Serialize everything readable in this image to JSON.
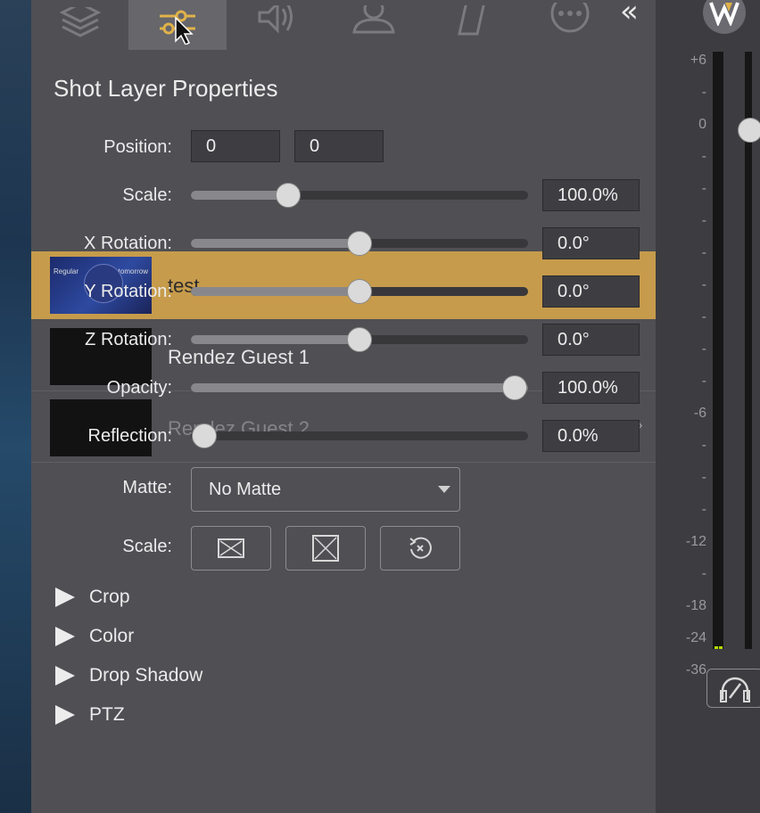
{
  "toolbar": {
    "icons": [
      "layers-icon",
      "adjustments-icon",
      "speaker-icon",
      "person-icon",
      "slash-shape-icon",
      "more-icon"
    ],
    "active_index": 1,
    "collapse_label": "«"
  },
  "panel": {
    "title": "Shot Layer Properties",
    "position": {
      "label": "Position:",
      "x": "0",
      "y": "0"
    },
    "scale": {
      "label": "Scale:",
      "value": "100.0%",
      "fraction": 0.27
    },
    "x_rotation": {
      "label": "X Rotation:",
      "value": "0.0°",
      "fraction": 0.5
    },
    "y_rotation": {
      "label": "Y Rotation:",
      "value": "0.0°",
      "fraction": 0.5
    },
    "z_rotation": {
      "label": "Z Rotation:",
      "value": "0.0°",
      "fraction": 0.5
    },
    "opacity": {
      "label": "Opacity:",
      "value": "100.0%",
      "fraction": 1.0
    },
    "reflection": {
      "label": "Reflection:",
      "value": "0.0%",
      "fraction": 0.0
    },
    "matte": {
      "label": "Matte:",
      "value": "No Matte"
    },
    "scale_buttons": {
      "label": "Scale:",
      "icons": [
        "fit-icon",
        "fill-icon",
        "reset-icon"
      ]
    },
    "sections": [
      "Crop",
      "Color",
      "Drop Shadow",
      "PTZ"
    ]
  },
  "layers_list": {
    "rows": [
      {
        "name": "test",
        "selected": true
      },
      {
        "name": "Rendez Guest 1",
        "selected": false
      },
      {
        "name": "Rendez Guest 2",
        "selected": false
      }
    ],
    "thumb_texts": [
      "Regular",
      "tomorrow"
    ]
  },
  "meter": {
    "ticks": [
      "+6",
      "-",
      "0",
      "-",
      "-",
      "-",
      "-",
      "-",
      "-",
      "-",
      "-",
      "-6",
      "-",
      "-",
      "-",
      "-12",
      "-",
      "-18",
      "-24",
      "-36"
    ],
    "fader_level": 0.13
  },
  "colors": {
    "selection": "#c69b4b",
    "panel_bg": "#4f4f54",
    "accent": "#e0b24a"
  }
}
